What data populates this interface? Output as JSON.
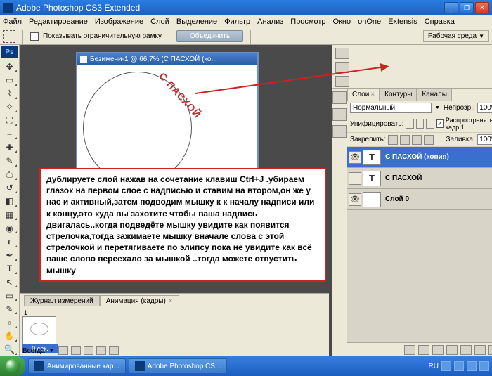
{
  "titlebar": {
    "title": "Adobe Photoshop CS3 Extended"
  },
  "menubar": [
    "Файл",
    "Редактирование",
    "Изображение",
    "Слой",
    "Выделение",
    "Фильтр",
    "Анализ",
    "Просмотр",
    "Окно",
    "onOne",
    "Extensis",
    "Справка"
  ],
  "optbar": {
    "boundbox_label": "Показывать ограничительную рамку",
    "combine_label": "Объединить",
    "workspace_label": "Рабочая среда"
  },
  "doc": {
    "title": "Безимени-1 @ 66,7% (С ПАСХОЙ (ко...",
    "curved_text": "С ПАСХОЙ"
  },
  "infobox": "дублируете слой нажав на сочетание клавиш Ctrl+J .убираем глазок на первом слое с надписью и ставим на втором,он же у нас и активный,затем подводим мышку к к началу надписи или к концу,это куда вы захотите чтобы ваша надпись двигалась..когда подведёте мышку увидите как появится стрелочка,тогда зажимаете мышку вначале слова с этой стрелочкой и перетягиваете по элипсу пока не увидите как всё ваше слово переехало за мышкой ..тогда можете отпустить мышку",
  "bottom": {
    "tabs": [
      "Журнал измерений",
      "Анимация (кадры)"
    ],
    "frame_num": "1",
    "frame_dur": "0 сек.",
    "loop": "Всегда"
  },
  "layers": {
    "tabs": [
      "Слои",
      "Контуры",
      "Каналы"
    ],
    "blend": "Нормальный",
    "opacity_label": "Непрозр.:",
    "opacity": "100%",
    "unify_label": "Унифицировать:",
    "propagate_label": "Распространять кадр 1",
    "lock_label": "Закрепить:",
    "fill_label": "Заливка:",
    "fill": "100%",
    "items": [
      {
        "type": "T",
        "name": "С ПАСХОЙ (копия)",
        "visible": true,
        "active": true
      },
      {
        "type": "T",
        "name": "С ПАСХОЙ",
        "visible": false,
        "active": false
      },
      {
        "type": "img",
        "name": "Слой 0",
        "visible": true,
        "active": false
      }
    ]
  },
  "taskbar": {
    "btn1": "Анимированные кар...",
    "btn2": "Adobe Photoshop CS...",
    "lang": "RU"
  }
}
